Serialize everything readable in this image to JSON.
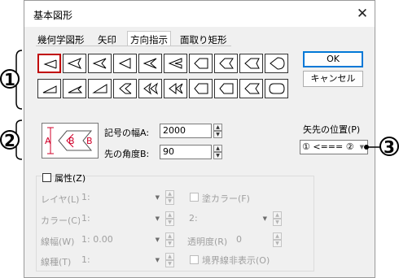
{
  "dialog": {
    "title": "基本図形",
    "close_glyph": "✕"
  },
  "tabs": [
    {
      "label": "幾何学図形",
      "active": false
    },
    {
      "label": "矢印",
      "active": false
    },
    {
      "label": "方向指示",
      "active": true
    },
    {
      "label": "面取り矩形",
      "active": false
    }
  ],
  "shapes": {
    "selected_index": 0,
    "row1": [
      "triangle-open-pointer",
      "pointer-notch-1",
      "pointer-notch-2",
      "pointer-notch-3",
      "pointer-notch-4",
      "pointer-notch-5",
      "pointer-flat-tail",
      "pointer-notch-tail",
      "pointer-arrow-tail",
      "pointer-round-tail"
    ],
    "row2": [
      "wedge-flat",
      "wedge-notch-1",
      "wedge-notch-2",
      "double-pointer-1",
      "double-pointer-2",
      "double-pointer-3",
      "box-pointer",
      "box-notch",
      "box-arrow",
      "box-round"
    ]
  },
  "buttons": {
    "ok": "OK",
    "cancel": "キャンセル"
  },
  "preview": {
    "label_a": "A",
    "label_b": "B",
    "label_b2": "B"
  },
  "fields": {
    "width_label": "記号の幅A:",
    "width_value": "2000",
    "angle_label": "先の角度B:",
    "angle_value": "90"
  },
  "arrow_position": {
    "label": "矢先の位置(P)",
    "value": "① <=== ②"
  },
  "attributes": {
    "group_label": "属性(Z)",
    "layer_label": "レイヤ(L)",
    "layer_value": "1:",
    "color_label": "カラー(C)",
    "color_value": "1:",
    "fill_color_label": "塗カラー(F)",
    "fill_color_value": "2:",
    "line_width_label": "線幅(W)",
    "line_width_value": "1: 0.00",
    "transparency_label": "透明度(R)",
    "transparency_value": "0",
    "line_type_label": "線種(T)",
    "line_type_value": "1:",
    "hide_border_label": "境界線非表示(O)"
  },
  "callouts": {
    "one": "1",
    "two": "2",
    "three": "3"
  },
  "colors": {
    "accent": "#0078d7",
    "selected": "#c00000",
    "preview_red": "#d0002a"
  }
}
